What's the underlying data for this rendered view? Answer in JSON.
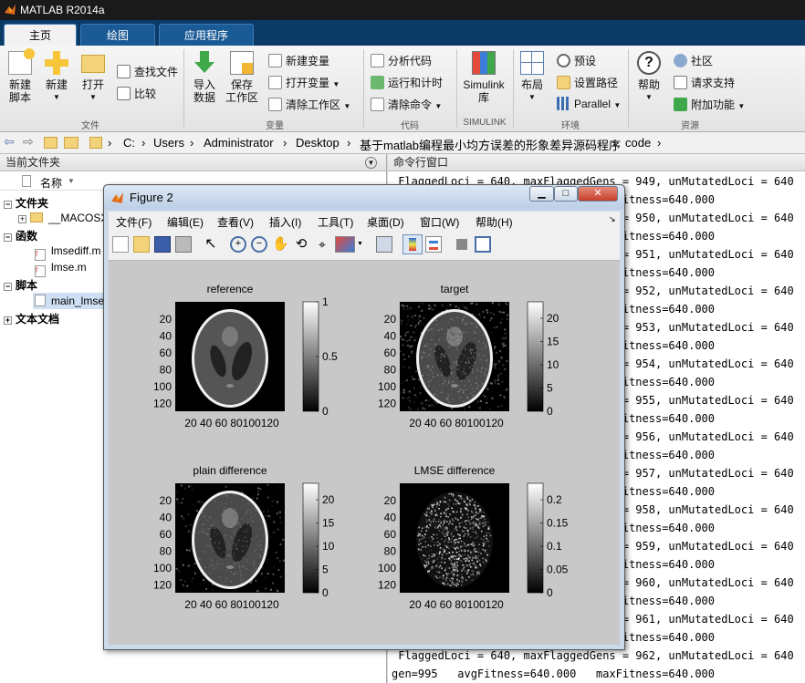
{
  "app": {
    "title": "MATLAB R2014a"
  },
  "ribbon_tabs": [
    {
      "label": "主页",
      "active": true
    },
    {
      "label": "绘图",
      "active": false
    },
    {
      "label": "应用程序",
      "active": false
    }
  ],
  "ribbon": {
    "file_group": {
      "new_script": "新建\n脚本",
      "new": "新建",
      "open": "打开",
      "find_files": "查找文件",
      "compare": "比较",
      "label": "文件"
    },
    "variable_group": {
      "import_data": "导入\n数据",
      "save_workspace": "保存\n工作区",
      "new_variable": "新建变量",
      "open_variable": "打开变量",
      "clear_workspace": "清除工作区",
      "label": "变量"
    },
    "code_group": {
      "analyze_code": "分析代码",
      "run_and_time": "运行和计时",
      "clear_commands": "清除命令",
      "label": "代码"
    },
    "simulink_group": {
      "simulink_library": "Simulink\n库",
      "label": "SIMULINK"
    },
    "environment_group": {
      "layout": "布局",
      "preferences": "预设",
      "set_path": "设置路径",
      "parallel": "Parallel",
      "label": "环境"
    },
    "resources_group": {
      "help": "帮助",
      "community": "社区",
      "request_support": "请求支持",
      "add_ons": "附加功能",
      "label": "资源"
    }
  },
  "address": {
    "crumbs": [
      "C:",
      "Users",
      "Administrator",
      "Desktop",
      "基于matlab编程最小均方误差的形象差异源码程序",
      "code"
    ]
  },
  "current_folder": {
    "title": "当前文件夹",
    "column_name": "名称",
    "sections": {
      "folders": "文件夹",
      "macos": "__MACOSX",
      "functions": "函数",
      "lmsediff": "lmsediff.m",
      "lmse": "lmse.m",
      "scripts": "脚本",
      "main": "main_lmse.m",
      "text_docs": "文本文档"
    }
  },
  "command_window": {
    "title": "命令行窗口",
    "lines": [
      " FlaggedLoci = 640, maxFlaggedGens = 949, unMutatedLoci = 640",
      "gen=982   avgFitness=640.000   maxFitness=640.000",
      " FlaggedLoci = 640, maxFlaggedGens = 950, unMutatedLoci = 640",
      "gen=983   avgFitness=640.000   maxFitness=640.000",
      " FlaggedLoci = 640, maxFlaggedGens = 951, unMutatedLoci = 640",
      "gen=984   avgFitness=640.000   maxFitness=640.000",
      " FlaggedLoci = 640, maxFlaggedGens = 952, unMutatedLoci = 640",
      "gen=985   avgFitness=640.000   maxFitness=640.000",
      " FlaggedLoci = 640, maxFlaggedGens = 953, unMutatedLoci = 640",
      "gen=986   avgFitness=640.000   maxFitness=640.000",
      " FlaggedLoci = 640, maxFlaggedGens = 954, unMutatedLoci = 640",
      "gen=987   avgFitness=640.000   maxFitness=640.000",
      " FlaggedLoci = 640, maxFlaggedGens = 955, unMutatedLoci = 640",
      "gen=988   avgFitness=640.000   maxFitness=640.000",
      " FlaggedLoci = 640, maxFlaggedGens = 956, unMutatedLoci = 640",
      "gen=989   avgFitness=640.000   maxFitness=640.000",
      " FlaggedLoci = 640, maxFlaggedGens = 957, unMutatedLoci = 640",
      "gen=990   avgFitness=640.000   maxFitness=640.000",
      " FlaggedLoci = 640, maxFlaggedGens = 958, unMutatedLoci = 640",
      "gen=991   avgFitness=640.000   maxFitness=640.000",
      " FlaggedLoci = 640, maxFlaggedGens = 959, unMutatedLoci = 640",
      "gen=992   avgFitness=640.000   maxFitness=640.000",
      " FlaggedLoci = 640, maxFlaggedGens = 960, unMutatedLoci = 640",
      "gen=993   avgFitness=640.000   maxFitness=640.000",
      " FlaggedLoci = 640, maxFlaggedGens = 961, unMutatedLoci = 640",
      "gen=994   avgFitness=640.000   maxFitness=640.000",
      " FlaggedLoci = 640, maxFlaggedGens = 962, unMutatedLoci = 640",
      "gen=995   avgFitness=640.000   maxFitness=640.000"
    ]
  },
  "figure": {
    "title": "Figure 2",
    "menu": [
      "文件(F)",
      "编辑(E)",
      "查看(V)",
      "插入(I)",
      "工具(T)",
      "桌面(D)",
      "窗口(W)",
      "帮助(H)"
    ],
    "plots": [
      {
        "title": "reference",
        "cbar_ticks": [
          "1",
          "0.5",
          "0"
        ],
        "noise": "none"
      },
      {
        "title": "target",
        "cbar_ticks": [
          "20",
          "15",
          "10",
          "5",
          "0"
        ],
        "noise": "heavy"
      },
      {
        "title": "plain difference",
        "cbar_ticks": [
          "20",
          "15",
          "10",
          "5",
          "0"
        ],
        "noise": "medium"
      },
      {
        "title": "LMSE difference",
        "cbar_ticks": [
          "0.2",
          "0.15",
          "0.1",
          "0.05",
          "0"
        ],
        "noise": "speckle"
      }
    ],
    "y_ticks": [
      "20",
      "40",
      "60",
      "80",
      "100",
      "120"
    ],
    "x_ticks": "20 40 60 80100120"
  },
  "colors": {
    "ribbon_tab_bg": "#0c3a66",
    "title_bg": "#1a1a1a",
    "accent": "#1a5a95"
  }
}
